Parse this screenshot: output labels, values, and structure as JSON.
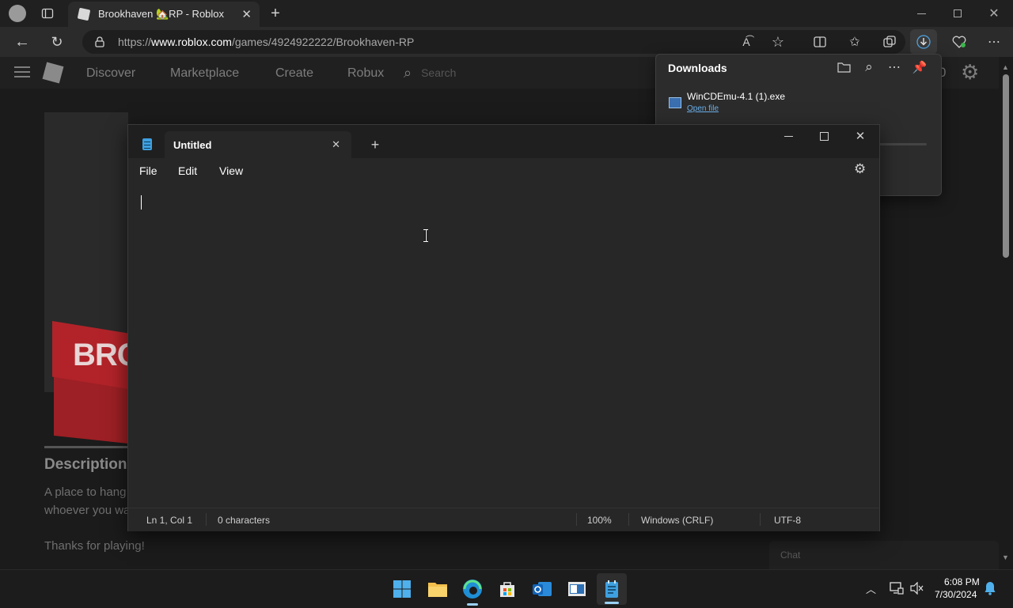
{
  "browser": {
    "tab_title": "Brookhaven 🏡RP - Roblox",
    "url_prefix": "https://",
    "url_domain": "www.roblox.com",
    "url_path": "/games/4924922222/Brookhaven-RP"
  },
  "roblox": {
    "nav": [
      "Discover",
      "Marketplace",
      "Create",
      "Robux"
    ],
    "search_placeholder": "Search",
    "banner_text": "BRO",
    "description_heading": "Description",
    "description_line1": "A place to hang out",
    "description_line2": "whoever you want",
    "thanks": "Thanks for playing!",
    "chat_label": "Chat",
    "robux_count": "0"
  },
  "downloads": {
    "title": "Downloads",
    "file_name": "WinCDEmu-4.1 (1).exe",
    "open_file": "Open file"
  },
  "notepad": {
    "tab_title": "Untitled",
    "menu": [
      "File",
      "Edit",
      "View"
    ],
    "status": {
      "position": "Ln 1, Col 1",
      "characters": "0 characters",
      "zoom": "100%",
      "line_ending": "Windows (CRLF)",
      "encoding": "UTF-8"
    }
  },
  "taskbar": {
    "time": "6:08 PM",
    "date": "7/30/2024"
  },
  "colors": {
    "edge_accent": "#4fa3e0",
    "notepad_icon": "#3ea0e0",
    "roblox_banner": "#c0272d"
  }
}
